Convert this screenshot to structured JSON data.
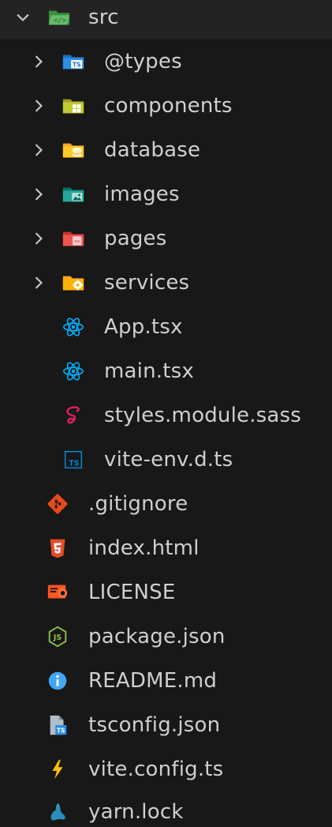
{
  "explorer": {
    "root": {
      "label": "src",
      "expanded": true,
      "icon": "folder-src-open-icon",
      "color": "#4caf50"
    },
    "folders": [
      {
        "label": "@types",
        "icon": "folder-types-icon",
        "color": "#2d8ee6"
      },
      {
        "label": "components",
        "icon": "folder-components-icon",
        "color": "#c0ca33"
      },
      {
        "label": "database",
        "icon": "folder-database-icon",
        "color": "#ffca28"
      },
      {
        "label": "images",
        "icon": "folder-images-icon",
        "color": "#26a69a"
      },
      {
        "label": "pages",
        "icon": "folder-pages-icon",
        "color": "#ef5350"
      },
      {
        "label": "services",
        "icon": "folder-services-icon",
        "color": "#ffb300"
      }
    ],
    "src_files": [
      {
        "label": "App.tsx",
        "icon": "react-icon",
        "color": "#03a9f4"
      },
      {
        "label": "main.tsx",
        "icon": "react-icon",
        "color": "#03a9f4"
      },
      {
        "label": "styles.module.sass",
        "icon": "sass-icon",
        "color": "#e91e63"
      },
      {
        "label": "vite-env.d.ts",
        "icon": "typescript-def-icon",
        "color": "#0288d1"
      }
    ],
    "root_files": [
      {
        "label": ".gitignore",
        "icon": "git-icon",
        "color": "#e64a19"
      },
      {
        "label": "index.html",
        "icon": "html5-icon",
        "color": "#e44d26"
      },
      {
        "label": "LICENSE",
        "icon": "license-icon",
        "color": "#ff5722"
      },
      {
        "label": "package.json",
        "icon": "nodejs-icon",
        "color": "#8bc34a"
      },
      {
        "label": "README.md",
        "icon": "info-icon",
        "color": "#42a5f5"
      },
      {
        "label": "tsconfig.json",
        "icon": "tsconfig-icon",
        "color": "#2d8ee6"
      },
      {
        "label": "vite.config.ts",
        "icon": "vite-icon",
        "color": "#ffc107"
      },
      {
        "label": "yarn.lock",
        "icon": "yarn-icon",
        "color": "#2c8ebb"
      }
    ]
  }
}
